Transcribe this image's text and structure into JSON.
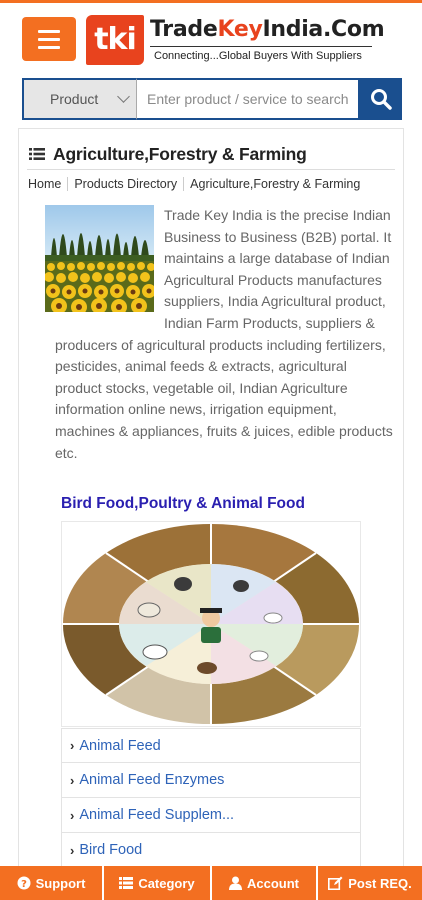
{
  "header": {
    "logo_mark": "tki",
    "logo_name_prefix": "Trade",
    "logo_name_key": "Key",
    "logo_name_suffix": "India.Com",
    "tagline": "Connecting...Global Buyers With Suppliers"
  },
  "search": {
    "select_value": "Product",
    "placeholder": "Enter product / service to search"
  },
  "page": {
    "title": "Agriculture,Forestry & Farming",
    "breadcrumb": [
      "Home",
      "Products Directory",
      "Agriculture,Forestry & Farming"
    ],
    "description": "Trade Key India is the precise Indian Business to Business (B2B) portal. It maintains a large database of Indian Agricultural Products manufactures suppliers, India Agricultural product, Indian Farm Products, suppliers & producers of agricultural products including fertilizers, pesticides, animal feeds & extracts, agricultural product stocks, vegetable oil, Indian Agriculture information online news, irrigation equipment, machines & appliances, fruits & juices, edible products etc."
  },
  "category": {
    "title": "Bird Food,Poultry & Animal Food",
    "items": [
      "Animal Feed",
      "Animal Feed Enzymes",
      "Animal Feed Supplem...",
      "Bird Food"
    ]
  },
  "bottom_nav": {
    "support": "Support",
    "category": "Category",
    "account": "Account",
    "post_req": "Post REQ."
  },
  "colors": {
    "brand_orange": "#f36f21",
    "logo_red": "#e8431e",
    "search_blue": "#1a4f8f",
    "subtitle_blue": "#2a1fb0",
    "link_blue": "#2e63b8"
  }
}
